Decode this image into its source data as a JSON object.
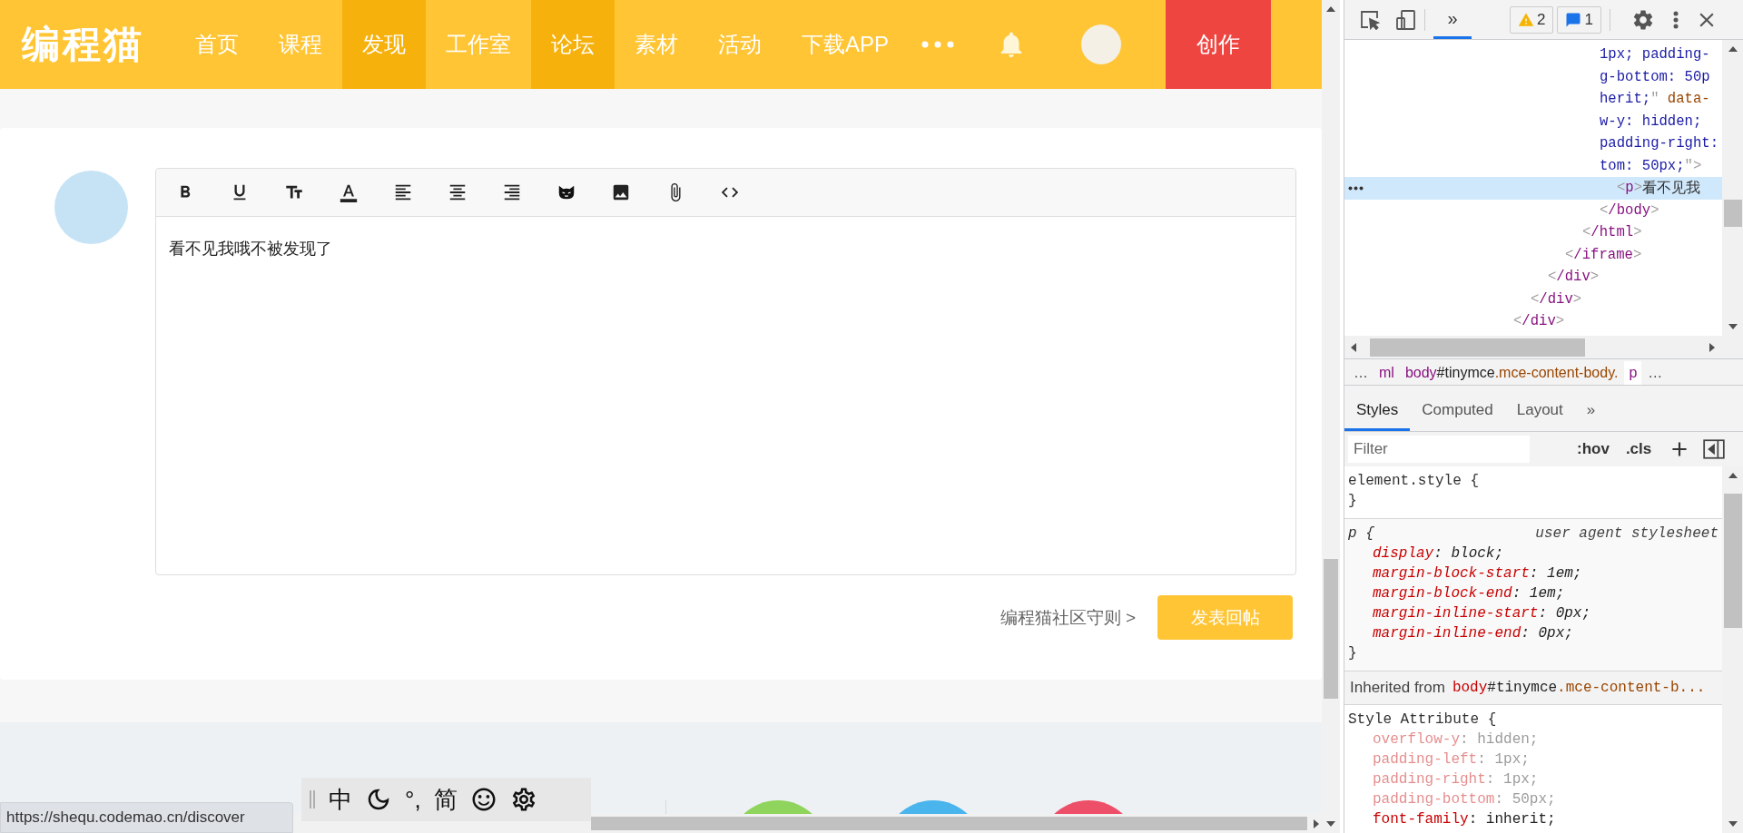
{
  "header": {
    "logo": "编程猫",
    "nav": [
      {
        "label": "首页",
        "highlighted": false
      },
      {
        "label": "课程",
        "highlighted": false
      },
      {
        "label": "发现",
        "highlighted": true
      },
      {
        "label": "工作室",
        "highlighted": false
      },
      {
        "label": "论坛",
        "highlighted": true
      },
      {
        "label": "素材",
        "highlighted": false
      },
      {
        "label": "活动",
        "highlighted": false
      },
      {
        "label": "下载APP",
        "highlighted": false
      }
    ],
    "create_button": "创作"
  },
  "reply": {
    "toolbar": [
      {
        "kind": "bold"
      },
      {
        "kind": "underline"
      },
      {
        "kind": "text-size"
      },
      {
        "kind": "font-color"
      },
      {
        "kind": "align-left"
      },
      {
        "kind": "align-center"
      },
      {
        "kind": "align-right"
      },
      {
        "kind": "cat"
      },
      {
        "kind": "image"
      },
      {
        "kind": "attach"
      },
      {
        "kind": "code"
      }
    ],
    "content": "看不见我哦不被发现了",
    "rules_link": "编程猫社区守则 >",
    "submit_button": "发表回帖"
  },
  "footer": {
    "circles": [
      {
        "color": "#8fd45c"
      },
      {
        "color": "#4ab4ec"
      },
      {
        "color": "#ee4f68"
      }
    ]
  },
  "ime_bar": {
    "items": [
      {
        "kind": "text",
        "text": "中"
      },
      {
        "kind": "moon"
      },
      {
        "kind": "text",
        "text": "°,"
      },
      {
        "kind": "text",
        "text": "简"
      },
      {
        "kind": "smile"
      },
      {
        "kind": "gear"
      }
    ]
  },
  "status_url": "https://shequ.codemao.cn/discover",
  "devtools": {
    "panel_tabs": [
      {
        "label": "»",
        "selected": true
      }
    ],
    "warnings": "2",
    "messages": "1",
    "elements": [
      {
        "selected": false,
        "close": [
          {
            "color": "#a09a9a",
            "t": "<"
          },
          {
            "color": "#881280",
            "t": "/div"
          },
          {
            "color": "#a09a9a",
            "t": ">"
          }
        ],
        "children": [
          {
            "selected": false,
            "close": [
              {
                "color": "#a09a9a",
                "t": "<"
              },
              {
                "color": "#881280",
                "t": "/div"
              },
              {
                "color": "#a09a9a",
                "t": ">"
              }
            ],
            "children": [
              {
                "selected": false,
                "close": [
                  {
                    "color": "#a09a9a",
                    "t": "<"
                  },
                  {
                    "color": "#881280",
                    "t": "/div"
                  },
                  {
                    "color": "#a09a9a",
                    "t": ">"
                  }
                ],
                "children": [
                  {
                    "selected": false,
                    "close": [
                      {
                        "color": "#a09a9a",
                        "t": "<"
                      },
                      {
                        "color": "#881280",
                        "t": "/iframe"
                      },
                      {
                        "color": "#a09a9a",
                        "t": ">"
                      }
                    ],
                    "children": [
                      {
                        "selected": false,
                        "close": [
                          {
                            "color": "#a09a9a",
                            "t": "<"
                          },
                          {
                            "color": "#881280",
                            "t": "/html"
                          },
                          {
                            "color": "#a09a9a",
                            "t": ">"
                          }
                        ],
                        "children": [
                          {
                            "selected": false,
                            "open": [
                              [
                                {
                                  "color": "#1a1aa6",
                                  "t": "1px; padding-"
                                }
                              ],
                              [
                                {
                                  "color": "#1a1aa6",
                                  "t": "g-bottom: 50p"
                                }
                              ],
                              [
                                {
                                  "color": "#1a1aa6",
                                  "t": "herit;"
                                },
                                {
                                  "color": "#a09a9a",
                                  "t": "\""
                                },
                                {
                                  "color": "#994500",
                                  "t": " data-"
                                }
                              ],
                              [
                                {
                                  "color": "#1a1aa6",
                                  "t": "w-y: hidden;"
                                }
                              ],
                              [
                                {
                                  "color": "#1a1aa6",
                                  "t": "padding-right:"
                                }
                              ],
                              [
                                {
                                  "color": "#1a1aa6",
                                  "t": "tom: 50px;"
                                },
                                {
                                  "color": "#a09a9a",
                                  "t": "\">"
                                }
                              ]
                            ],
                            "close": [
                              {
                                "color": "#a09a9a",
                                "t": "<"
                              },
                              {
                                "color": "#881280",
                                "t": "/body"
                              },
                              {
                                "color": "#a09a9a",
                                "t": ">"
                              }
                            ],
                            "children": [
                              {
                                "selected": true,
                                "open": [
                                  [
                                    {
                                      "color": "#a09a9a",
                                      "t": "<"
                                    },
                                    {
                                      "color": "#881280",
                                      "t": "p"
                                    },
                                    {
                                      "color": "#a09a9a",
                                      "t": ">"
                                    },
                                    {
                                      "color": "#333333",
                                      "t": "看不见我"
                                    }
                                  ]
                                ]
                              }
                            ]
                          }
                        ]
                      }
                    ]
                  }
                ]
              }
            ]
          }
        ]
      }
    ],
    "breadcrumbs": [
      {
        "parts": [
          {
            "t": "…"
          }
        ],
        "selected": false
      },
      {
        "parts": [
          {
            "color": "#881280",
            "t": "ml"
          }
        ],
        "selected": false
      },
      {
        "parts": [
          {
            "color": "#881280",
            "t": "body"
          },
          {
            "color": "#222222",
            "t": "#tinymce"
          },
          {
            "color": "#994500",
            "t": ".mce-content-body."
          }
        ],
        "selected": false
      },
      {
        "parts": [
          {
            "color": "#881280",
            "t": "p"
          }
        ],
        "selected": true
      },
      {
        "parts": [
          {
            "t": "…"
          }
        ],
        "selected": false
      }
    ],
    "styles_tabs": [
      {
        "label": "Styles",
        "selected": true
      },
      {
        "label": "Computed",
        "selected": false
      },
      {
        "label": "Layout",
        "selected": false
      },
      {
        "label": "»",
        "selected": false
      }
    ],
    "filter_placeholder": "Filter",
    "hov": ":hov",
    "cls": ".cls",
    "rules": [
      {
        "kind": "rule",
        "user_agent": false,
        "selector": "element.style {",
        "close": "}"
      },
      {
        "kind": "rule",
        "user_agent": true,
        "selector": "p {",
        "source": "user agent stylesheet",
        "props": [
          {
            "name": "display",
            "value": ": block;",
            "inactive": false
          },
          {
            "name": "margin-block-start",
            "value": ": 1em;",
            "inactive": false
          },
          {
            "name": "margin-block-end",
            "value": ": 1em;",
            "inactive": false
          },
          {
            "name": "margin-inline-start",
            "value": ": 0px;",
            "inactive": false
          },
          {
            "name": "margin-inline-end",
            "value": ": 0px;",
            "inactive": false
          }
        ],
        "close": "}"
      },
      {
        "kind": "inherited",
        "label": "Inherited from",
        "parts": [
          {
            "color": "#c80000",
            "t": "body"
          },
          {
            "color": "#222222",
            "t": "#tinymce"
          },
          {
            "color": "#994500",
            "t": ".mce-content-b..."
          }
        ]
      },
      {
        "kind": "rule",
        "user_agent": false,
        "selector": "Style Attribute {",
        "props": [
          {
            "name": "overflow-y",
            "value": ": hidden;",
            "inactive": true
          },
          {
            "name": "padding-left",
            "value": ": 1px;",
            "inactive": true
          },
          {
            "name": "padding-right",
            "value": ": 1px;",
            "inactive": true
          },
          {
            "name": "padding-bottom",
            "value": ": 50px;",
            "inactive": true
          },
          {
            "name": "font-family",
            "value": ": inherit;",
            "inactive": false
          }
        ]
      }
    ]
  }
}
